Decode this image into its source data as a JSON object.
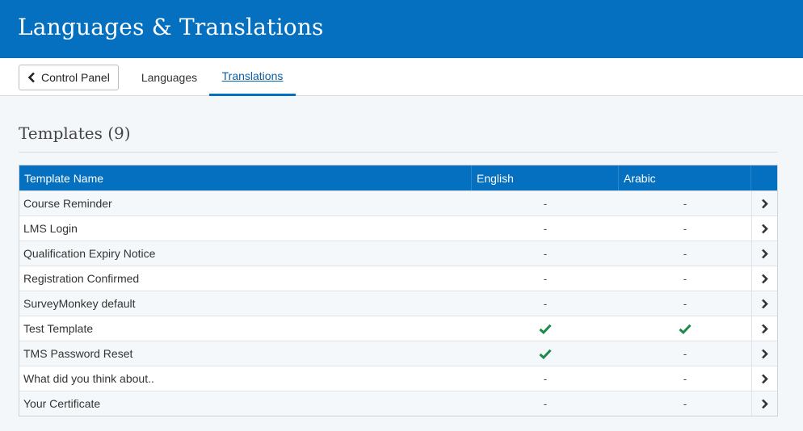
{
  "header": {
    "title": "Languages & Translations"
  },
  "nav": {
    "back_label": "Control Panel",
    "tabs": [
      {
        "label": "Languages",
        "active": false
      },
      {
        "label": "Translations",
        "active": true
      }
    ]
  },
  "section": {
    "title": "Templates (9)"
  },
  "table": {
    "columns": [
      "Template Name",
      "English",
      "Arabic"
    ],
    "rows": [
      {
        "name": "Course Reminder",
        "english": "-",
        "arabic": "-"
      },
      {
        "name": "LMS Login",
        "english": "-",
        "arabic": "-"
      },
      {
        "name": "Qualification Expiry Notice",
        "english": "-",
        "arabic": "-"
      },
      {
        "name": "Registration Confirmed",
        "english": "-",
        "arabic": "-"
      },
      {
        "name": "SurveyMonkey default",
        "english": "-",
        "arabic": "-"
      },
      {
        "name": "Test Template",
        "english": "check",
        "arabic": "check"
      },
      {
        "name": "TMS Password Reset",
        "english": "check",
        "arabic": "-"
      },
      {
        "name": "What did you think about..",
        "english": "-",
        "arabic": "-"
      },
      {
        "name": "Your Certificate",
        "english": "-",
        "arabic": "-"
      }
    ]
  },
  "colors": {
    "brand": "#0570c0",
    "check": "#1f8a4c",
    "arrow": "#333333"
  },
  "icons": {
    "back": "chevron-left-icon",
    "row_action": "chevron-right-icon",
    "translated": "checkmark-icon"
  }
}
